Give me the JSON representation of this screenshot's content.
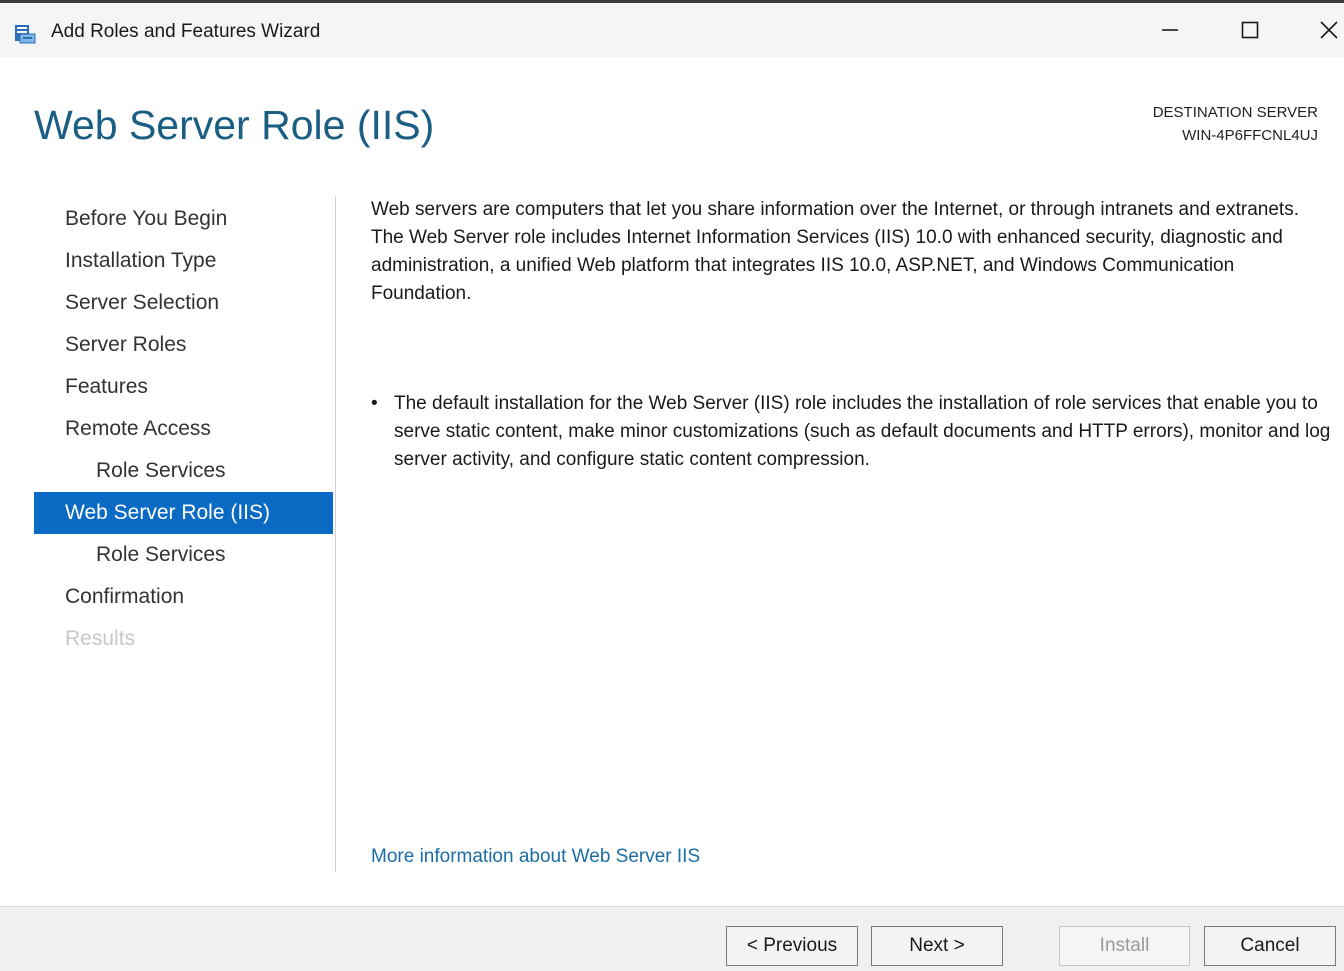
{
  "window": {
    "title": "Add Roles and Features Wizard",
    "minimize_icon": "minimize-icon",
    "maximize_icon": "maximize-icon",
    "close_icon": "close-icon"
  },
  "header": {
    "page_title": "Web Server Role (IIS)",
    "destination_label": "DESTINATION SERVER",
    "destination_server": "WIN-4P6FFCNL4UJ"
  },
  "nav": {
    "items": [
      {
        "label": "Before You Begin",
        "state": "normal",
        "level": 0
      },
      {
        "label": "Installation Type",
        "state": "normal",
        "level": 0
      },
      {
        "label": "Server Selection",
        "state": "normal",
        "level": 0
      },
      {
        "label": "Server Roles",
        "state": "normal",
        "level": 0
      },
      {
        "label": "Features",
        "state": "normal",
        "level": 0
      },
      {
        "label": "Remote Access",
        "state": "normal",
        "level": 0
      },
      {
        "label": "Role Services",
        "state": "normal",
        "level": 1
      },
      {
        "label": "Web Server Role (IIS)",
        "state": "active",
        "level": 0
      },
      {
        "label": "Role Services",
        "state": "normal",
        "level": 1
      },
      {
        "label": "Confirmation",
        "state": "normal",
        "level": 0
      },
      {
        "label": "Results",
        "state": "disabled",
        "level": 0
      }
    ]
  },
  "content": {
    "description": "Web servers are computers that let you share information over the Internet, or through intranets and extranets. The Web Server role includes Internet Information Services (IIS) 10.0 with enhanced security, diagnostic and administration, a unified Web platform that integrates IIS 10.0, ASP.NET, and Windows Communication Foundation.",
    "bullet_symbol": "•",
    "bullet": "The default installation for the Web Server (IIS) role includes the installation of role services that enable you to serve static content, make minor customizations (such as default documents and HTTP errors), monitor and log server activity, and configure static content compression.",
    "more_info_link": "More information about Web Server IIS"
  },
  "footer": {
    "previous": "< Previous",
    "next": "Next >",
    "install": "Install",
    "cancel": "Cancel"
  },
  "colors": {
    "accent": "#0a6ac4",
    "title": "#1b5e84",
    "link": "#1b6ea5",
    "disabled_text": "#c8c8c8"
  }
}
